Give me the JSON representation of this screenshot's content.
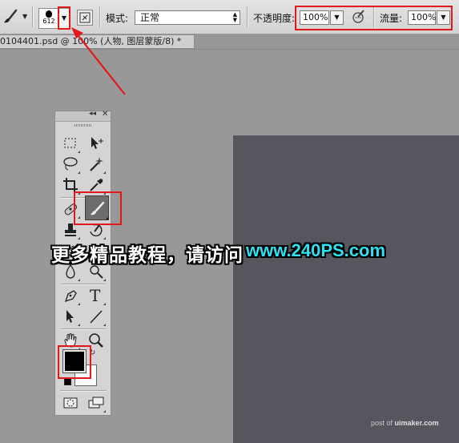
{
  "options_bar": {
    "brush_size": "612",
    "mode_label": "模式:",
    "mode_value": "正常",
    "opacity_label": "不透明度:",
    "opacity_value": "100%",
    "flow_label": "流量:",
    "flow_value": "100%"
  },
  "document_tab": {
    "title": "0104401.psd @ 100% (人物, 图层蒙版/8) *"
  },
  "toolbox": {
    "collapse_icon": "double-chevron-left-icon",
    "close_icon": "close-icon",
    "active_tool": "brush-tool",
    "type_tool_glyph": "T",
    "foreground_color": "#000000",
    "background_color": "#ffffff"
  },
  "watermark": {
    "chinese_text": "更多精品教程，请访问",
    "url_text": "www.240PS.com",
    "credit_prefix": "post of",
    "credit_site": "uimaker.com"
  },
  "colors": {
    "annotation_red": "#e4171b",
    "canvas": "#57565e",
    "workspace": "#989898",
    "watermark_url": "#2ee0f0"
  }
}
